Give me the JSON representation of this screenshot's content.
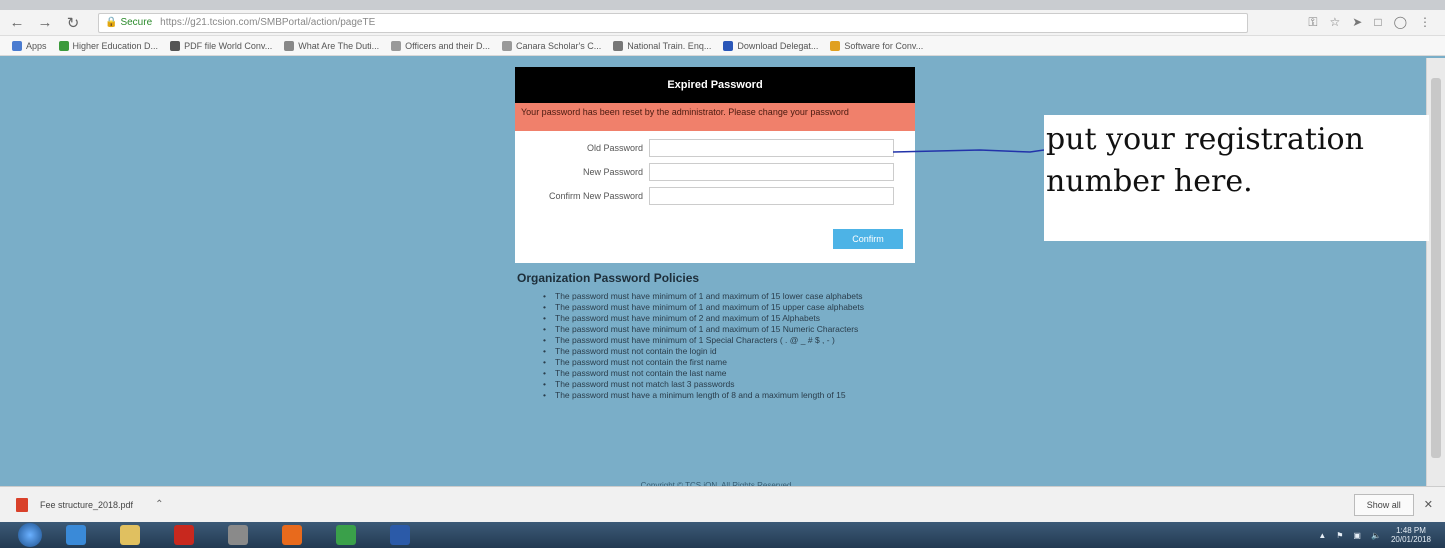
{
  "browser": {
    "address": {
      "secure_label": "Secure",
      "url": "https://g21.tcsion.com/SMBPortal/action/pageTE"
    },
    "bookmarks": [
      {
        "label": "Apps",
        "color": "#4a7bd0"
      },
      {
        "label": "Higher Education D...",
        "color": "#3c9a3c"
      },
      {
        "label": "PDF file World Conv...",
        "color": "#555555"
      },
      {
        "label": "What Are The Duti...",
        "color": "#888888"
      },
      {
        "label": "Officers and their D...",
        "color": "#999999"
      },
      {
        "label": "Canara Scholar's C...",
        "color": "#999999"
      },
      {
        "label": "National Train. Enq...",
        "color": "#777777"
      },
      {
        "label": "Download Delegat...",
        "color": "#2a56b8"
      },
      {
        "label": "Software for Conv...",
        "color": "#e0a020"
      }
    ]
  },
  "card": {
    "title": "Expired Password",
    "alert": "Your password has been reset by the administrator. Please change your password",
    "fields": {
      "old": {
        "label": "Old Password",
        "value": ""
      },
      "new": {
        "label": "New Password",
        "value": ""
      },
      "confirm": {
        "label": "Confirm New Password",
        "value": ""
      }
    },
    "confirm_button": "Confirm"
  },
  "policies": {
    "title": "Organization Password Policies",
    "items": [
      "The password must have minimum of 1 and maximum of 15 lower case alphabets",
      "The password must have minimum of 1 and maximum of 15 upper case alphabets",
      "The password must have minimum of 2 and maximum of 15 Alphabets",
      "The password must have minimum of 1 and maximum of 15 Numeric Characters",
      "The password must have minimum of 1 Special Characters ( . @ _ # $ , - )",
      "The password must not contain the login id",
      "The password must not contain the first name",
      "The password must not contain the last name",
      "The password must not match last 3 passwords",
      "The password must have a minimum length of 8 and a maximum length of 15"
    ],
    "footer": "Copyright © TCS iON. All Rights Reserved"
  },
  "annotation": {
    "text": "put your registration number here.",
    "line_color": "#2233aa"
  },
  "downloads": {
    "file_name": "Fee structure_2018.pdf",
    "show_all": "Show all"
  },
  "taskbar": {
    "time": "1:48 PM",
    "date": "20/01/2018",
    "apps": [
      {
        "name": "internet-explorer",
        "color": "#3a8ad8"
      },
      {
        "name": "file-explorer",
        "color": "#e0c060"
      },
      {
        "name": "acrobat",
        "color": "#c8281e"
      },
      {
        "name": "media",
        "color": "#8a8a8a"
      },
      {
        "name": "firefox",
        "color": "#e86a1c"
      },
      {
        "name": "chrome",
        "color": "#3aa04a"
      },
      {
        "name": "word",
        "color": "#2b5aa8"
      }
    ]
  }
}
